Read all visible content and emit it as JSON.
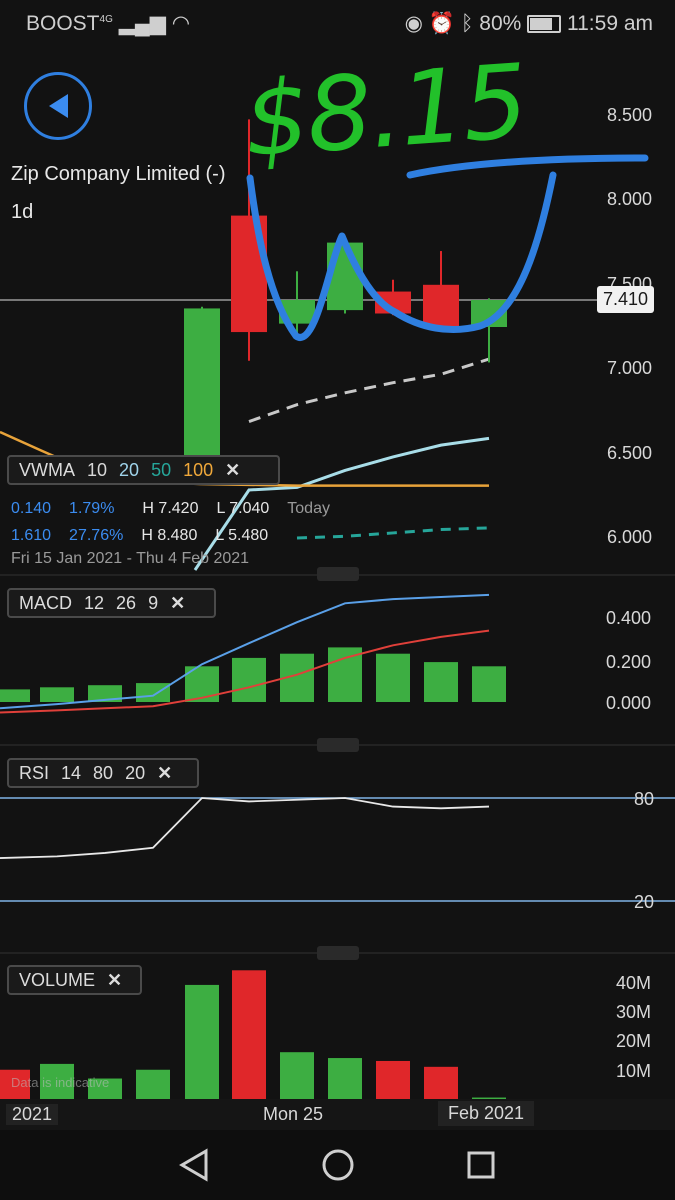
{
  "status": {
    "carrier": "BOOST",
    "network": "4G",
    "battery": "80%",
    "time": "11:59 am"
  },
  "instrument": {
    "name": "Zip Company Limited (-)",
    "interval": "1d",
    "last_price": "7.410"
  },
  "annotation": {
    "handwritten_price": "$8.15"
  },
  "price_axis": [
    "8.500",
    "8.000",
    "7.500",
    "7.000",
    "6.500",
    "6.000"
  ],
  "vwma": {
    "label": "VWMA",
    "p1": "10",
    "p2": "20",
    "p3": "50",
    "p4": "100",
    "p1_color": "#d8d8d8",
    "p2_color": "#9fd3ea",
    "p3_color": "#26a69a",
    "p4_color": "#f0a83a"
  },
  "info": {
    "change": "0.140",
    "change_pct": "1.79%",
    "high": "H 7.420",
    "low": "L 7.040",
    "period": "Today",
    "change2": "1.610",
    "change2_pct": "27.76%",
    "high2": "H 8.480",
    "low2": "L 5.480",
    "range": "Fri 15 Jan 2021 - Thu 4 Feb 2021"
  },
  "macd": {
    "label": "MACD",
    "fast": "12",
    "slow": "26",
    "signal": "9",
    "axis": [
      "0.400",
      "0.200",
      "0.000"
    ]
  },
  "rsi": {
    "label": "RSI",
    "length": "14",
    "upper": "80",
    "lower": "20",
    "axis": [
      "80",
      "20"
    ]
  },
  "volume": {
    "label": "VOLUME",
    "axis": [
      "40M",
      "30M",
      "20M",
      "10M"
    ],
    "note": "Data is indicative"
  },
  "time_axis": [
    "2021",
    "Mon 25",
    "Feb 2021"
  ],
  "colors": {
    "up": "#3dae42",
    "down": "#e0272a",
    "annotation_green": "#22c12a",
    "annotation_blue": "#2f7fe0"
  },
  "chart_data": {
    "type": "candlestick",
    "candles": [
      {
        "open": 6.45,
        "high": 7.37,
        "low": 6.45,
        "close": 7.36
      },
      {
        "open": 7.91,
        "high": 8.48,
        "low": 7.05,
        "close": 7.22
      },
      {
        "open": 7.27,
        "high": 7.58,
        "low": 7.18,
        "close": 7.41
      },
      {
        "open": 7.35,
        "high": 7.78,
        "low": 7.33,
        "close": 7.75
      },
      {
        "open": 7.46,
        "high": 7.53,
        "low": 7.32,
        "close": 7.33
      },
      {
        "open": 7.5,
        "high": 7.7,
        "low": 7.22,
        "close": 7.25
      },
      {
        "open": 7.25,
        "high": 7.42,
        "low": 7.04,
        "close": 7.41
      }
    ],
    "ma_dashed_gray": [
      null,
      6.69,
      6.79,
      6.86,
      6.92,
      6.97,
      7.06
    ],
    "ma_lightblue": [
      null,
      null,
      6.3,
      6.4,
      6.48,
      6.55,
      6.59
    ],
    "ma_orange_tail": [
      6.31,
      6.31,
      6.31,
      6.31,
      6.31
    ],
    "ma_teal_dashed": [
      6.0,
      6.01,
      6.03,
      6.05,
      6.06
    ],
    "macd_hist": [
      0.06,
      0.07,
      0.08,
      0.09,
      0.17,
      0.21,
      0.23,
      0.26,
      0.23,
      0.19,
      0.17
    ],
    "macd_line": [
      -0.03,
      -0.01,
      0.01,
      0.03,
      0.18,
      0.28,
      0.38,
      0.47,
      0.49,
      0.5,
      0.51
    ],
    "signal_line": [
      -0.05,
      -0.04,
      -0.03,
      -0.02,
      0.02,
      0.07,
      0.13,
      0.21,
      0.27,
      0.31,
      0.34
    ],
    "rsi": [
      45,
      46,
      48,
      51,
      80,
      78,
      79,
      80,
      75,
      74,
      75
    ],
    "volume_m": [
      10,
      12,
      7,
      10,
      39,
      44,
      16,
      14,
      13,
      11,
      0.5
    ],
    "volume_up": [
      false,
      true,
      true,
      true,
      true,
      false,
      true,
      true,
      false,
      false,
      true
    ]
  }
}
